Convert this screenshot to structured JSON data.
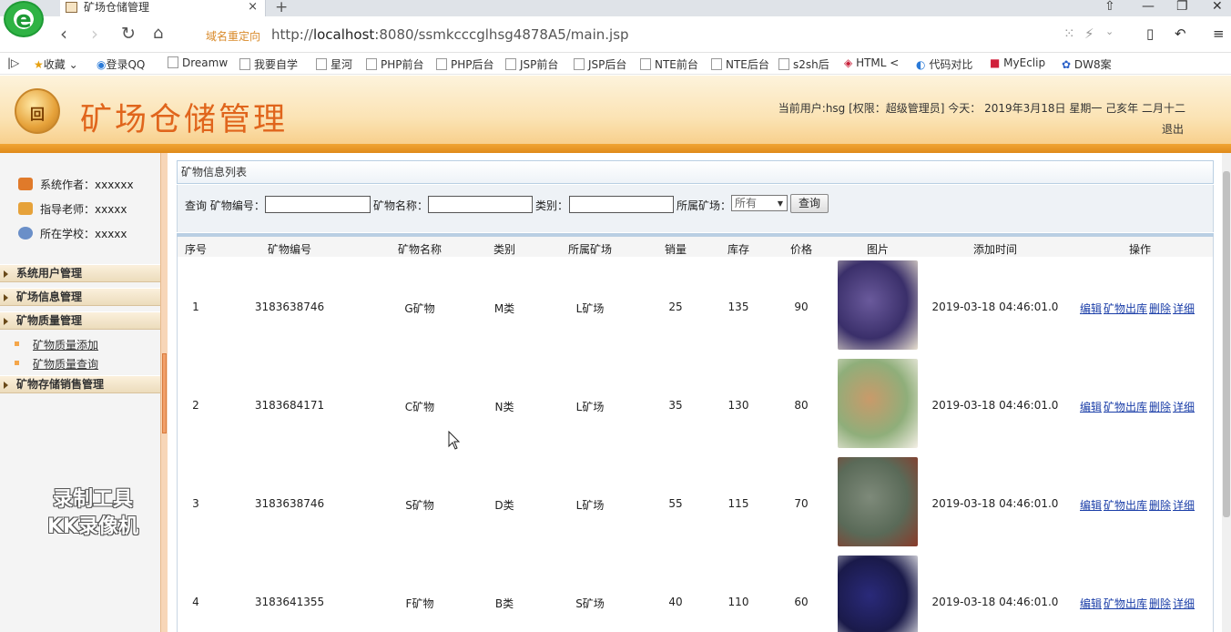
{
  "browser": {
    "logo_text": "e",
    "tab_title": "矿场仓储管理",
    "tab_close": "×",
    "new_tab": "+",
    "redirect_label": "域名重定向",
    "url_prefix": "http://",
    "url_host": "localhost",
    "url_rest": ":8080/ssmkcccglhsg4878A5/main.jsp",
    "bookmarks": [
      "收藏",
      "登录QQ",
      "Dreamw",
      "我要自学",
      "星河",
      "PHP前台",
      "PHP后台",
      "JSP前台",
      "JSP后台",
      "NTE前台",
      "NTE后台",
      "s2sh后",
      "HTML <",
      "代码对比",
      "MyEclip",
      "DW8案"
    ]
  },
  "header": {
    "logo_text": "回",
    "title": "矿场仓储管理",
    "user_info": "当前用户:hsg [权限：超级管理员] 今天： 2019年3月18日 星期一 己亥年 二月十二",
    "logout": "退出"
  },
  "sidebar": {
    "info": [
      {
        "label": "系统作者：xxxxxx",
        "icon": "user-icon",
        "color": "#e07a2a"
      },
      {
        "label": "指导老师：xxxxx",
        "icon": "clock-icon",
        "color": "#e6a23a"
      },
      {
        "label": "所在学校：xxxxx",
        "icon": "globe-icon",
        "color": "#6a8fc8"
      }
    ],
    "menus": [
      "系统用户管理",
      "矿场信息管理",
      "矿物质量管理"
    ],
    "sub_items": [
      "矿物质量添加",
      "矿物质量查询"
    ],
    "last_menu": "矿物存储销售管理",
    "watermark_line1": "录制工具",
    "watermark_line2": "KK录像机"
  },
  "main": {
    "panel_title": "矿物信息列表",
    "search": {
      "query_label": "查询 矿物编号：",
      "name_label": "矿物名称：",
      "category_label": "类别：",
      "mine_label": "所属矿场：",
      "mine_selected": "所有",
      "button": "查询"
    },
    "columns": [
      "序号",
      "矿物编号",
      "矿物名称",
      "类别",
      "所属矿场",
      "销量",
      "库存",
      "价格",
      "图片",
      "添加时间",
      "操作"
    ],
    "rows": [
      {
        "no": "1",
        "code": "3183638746",
        "name": "G矿物",
        "category": "M类",
        "mine": "L矿场",
        "sales": "25",
        "stock": "135",
        "price": "90",
        "time": "2019-03-18 04:46:01.0",
        "img_colors": [
          "#e9e1d0",
          "#6a5a9c",
          "#3a2f6a"
        ]
      },
      {
        "no": "2",
        "code": "3183684171",
        "name": "C矿物",
        "category": "N类",
        "mine": "L矿场",
        "sales": "35",
        "stock": "130",
        "price": "80",
        "time": "2019-03-18 04:46:01.0",
        "img_colors": [
          "#f4efe6",
          "#c99a6a",
          "#8fae7a"
        ]
      },
      {
        "no": "3",
        "code": "3183638746",
        "name": "S矿物",
        "category": "D类",
        "mine": "L矿场",
        "sales": "55",
        "stock": "115",
        "price": "70",
        "time": "2019-03-18 04:46:01.0",
        "img_colors": [
          "#8a3a2a",
          "#7e8a7a",
          "#5a6a58"
        ]
      },
      {
        "no": "4",
        "code": "3183641355",
        "name": "F矿物",
        "category": "B类",
        "mine": "S矿场",
        "sales": "40",
        "stock": "110",
        "price": "60",
        "time": "2019-03-18 04:46:01.0",
        "img_colors": [
          "#f2f2f2",
          "#2a2a7a",
          "#1a1a4a"
        ]
      }
    ],
    "ops": [
      "编辑",
      "矿物出库",
      "删除",
      "详细"
    ]
  }
}
